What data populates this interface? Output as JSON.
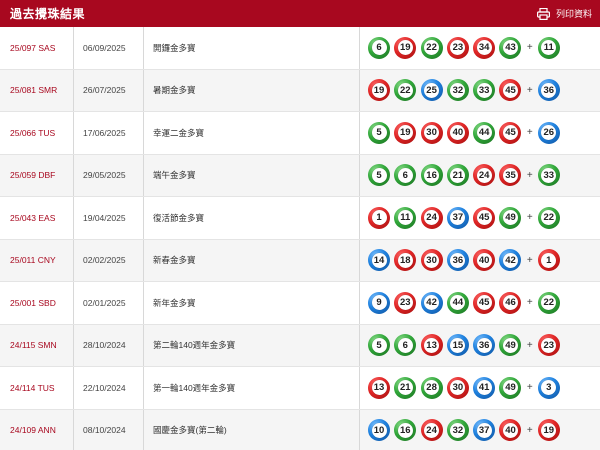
{
  "header": {
    "title": "過去攪珠結果",
    "print_label": "列印資料"
  },
  "colors": {
    "header_bg": "#a8081f",
    "draw_text": "#a8081f",
    "ball_red": "#e12626",
    "ball_blue": "#1f82e0",
    "ball_green": "#31a83a"
  },
  "results": [
    {
      "draw": "25/097 SAS",
      "date": "06/09/2025",
      "name": "開鑼金多寶",
      "balls": [
        6,
        19,
        22,
        23,
        34,
        43
      ],
      "extra": 11
    },
    {
      "draw": "25/081 SMR",
      "date": "26/07/2025",
      "name": "暑期金多寶",
      "balls": [
        19,
        22,
        25,
        32,
        33,
        45
      ],
      "extra": 36
    },
    {
      "draw": "25/066 TUS",
      "date": "17/06/2025",
      "name": "幸運二金多寶",
      "balls": [
        5,
        19,
        30,
        40,
        44,
        45
      ],
      "extra": 26
    },
    {
      "draw": "25/059 DBF",
      "date": "29/05/2025",
      "name": "端午金多寶",
      "balls": [
        5,
        6,
        16,
        21,
        24,
        35
      ],
      "extra": 33
    },
    {
      "draw": "25/043 EAS",
      "date": "19/04/2025",
      "name": "復活節金多寶",
      "balls": [
        1,
        11,
        24,
        37,
        45,
        49
      ],
      "extra": 22
    },
    {
      "draw": "25/011 CNY",
      "date": "02/02/2025",
      "name": "新春金多寶",
      "balls": [
        14,
        18,
        30,
        36,
        40,
        42
      ],
      "extra": 1
    },
    {
      "draw": "25/001 SBD",
      "date": "02/01/2025",
      "name": "新年金多寶",
      "balls": [
        9,
        23,
        42,
        44,
        45,
        46
      ],
      "extra": 22
    },
    {
      "draw": "24/115 SMN",
      "date": "28/10/2024",
      "name": "第二輪140週年金多寶",
      "balls": [
        5,
        6,
        13,
        15,
        36,
        49
      ],
      "extra": 23
    },
    {
      "draw": "24/114 TUS",
      "date": "22/10/2024",
      "name": "第一輪140週年金多寶",
      "balls": [
        13,
        21,
        28,
        30,
        41,
        49
      ],
      "extra": 3
    },
    {
      "draw": "24/109 ANN",
      "date": "08/10/2024",
      "name": "國慶金多寶(第二輪)",
      "balls": [
        10,
        16,
        24,
        32,
        37,
        40
      ],
      "extra": 19
    }
  ]
}
